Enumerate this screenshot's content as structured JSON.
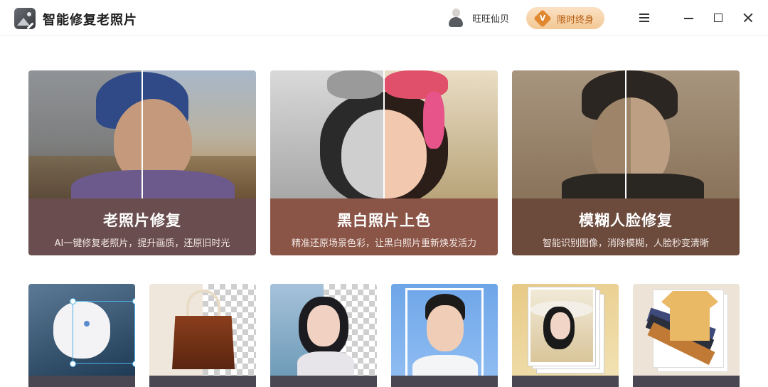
{
  "app": {
    "title": "智能修复老照片"
  },
  "user": {
    "name": "旺旺仙贝"
  },
  "vip": {
    "label": "限时终身",
    "badge": "V"
  },
  "features": [
    {
      "title": "老照片修复",
      "subtitle": "AI一键修复老照片，提升画质，还原旧时光",
      "color": "#6a4d4e"
    },
    {
      "title": "黑白照片上色",
      "subtitle": "精准还原场景色彩，让黑白照片重新焕发活力",
      "color": "#8a5446"
    },
    {
      "title": "模糊人脸修复",
      "subtitle": "智能识别图像，消除模糊，人脸秒变清晰",
      "color": "#6c4a3c"
    }
  ],
  "tools": [
    {
      "icon": "cat-crop-thumbnail"
    },
    {
      "icon": "handbag-cutout-thumbnail"
    },
    {
      "icon": "portrait-cutout-thumbnail"
    },
    {
      "icon": "id-photo-thumbnail"
    },
    {
      "icon": "photo-stack-portrait-thumbnail"
    },
    {
      "icon": "clothing-stack-thumbnail"
    }
  ]
}
